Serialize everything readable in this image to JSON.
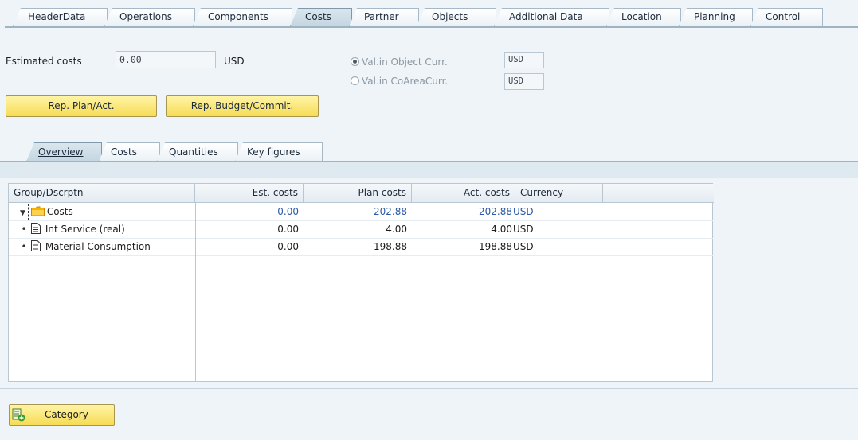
{
  "tabs": [
    {
      "label": "HeaderData",
      "active": false
    },
    {
      "label": "Operations",
      "active": false
    },
    {
      "label": "Components",
      "active": false
    },
    {
      "label": "Costs",
      "active": true
    },
    {
      "label": "Partner",
      "active": false
    },
    {
      "label": "Objects",
      "active": false
    },
    {
      "label": "Additional Data",
      "active": false
    },
    {
      "label": "Location",
      "active": false
    },
    {
      "label": "Planning",
      "active": false
    },
    {
      "label": "Control",
      "active": false
    }
  ],
  "header": {
    "estimated_costs_label": "Estimated costs",
    "estimated_costs_value": "0.00",
    "currency": "USD",
    "radio_object_curr_label": "Val.in Object Curr.",
    "radio_object_curr_value": "USD",
    "radio_coarea_label": "Val.in CoAreaCurr.",
    "radio_coarea_value": "USD",
    "selected_radio": "object"
  },
  "buttons": {
    "rep_plan_act": "Rep. Plan/Act.",
    "rep_budget_commit": "Rep. Budget/Commit.",
    "category": "Category"
  },
  "subtabs": [
    {
      "label": "Overview",
      "active": true
    },
    {
      "label": "Costs",
      "active": false
    },
    {
      "label": "Quantities",
      "active": false
    },
    {
      "label": "Key figures",
      "active": false
    }
  ],
  "table": {
    "columns": [
      "Group/Dscrptn",
      "Est. costs",
      "Plan costs",
      "Act. costs",
      "Currency"
    ],
    "rows": [
      {
        "name": "Costs",
        "est": "0.00",
        "plan": "202.88",
        "act": "202.88",
        "cur": "USD",
        "level": 0,
        "icon": "folder-icon"
      },
      {
        "name": "Int Service (real)",
        "est": "0.00",
        "plan": "4.00",
        "act": "4.00",
        "cur": "USD",
        "level": 1,
        "icon": "document-icon"
      },
      {
        "name": "Material Consumption",
        "est": "0.00",
        "plan": "198.88",
        "act": "198.88",
        "cur": "USD",
        "level": 1,
        "icon": "document-icon"
      }
    ]
  },
  "colors": {
    "accent_blue": "#2a5aa6",
    "button_yellow": "#f6dc55",
    "background": "#eef4f8"
  }
}
